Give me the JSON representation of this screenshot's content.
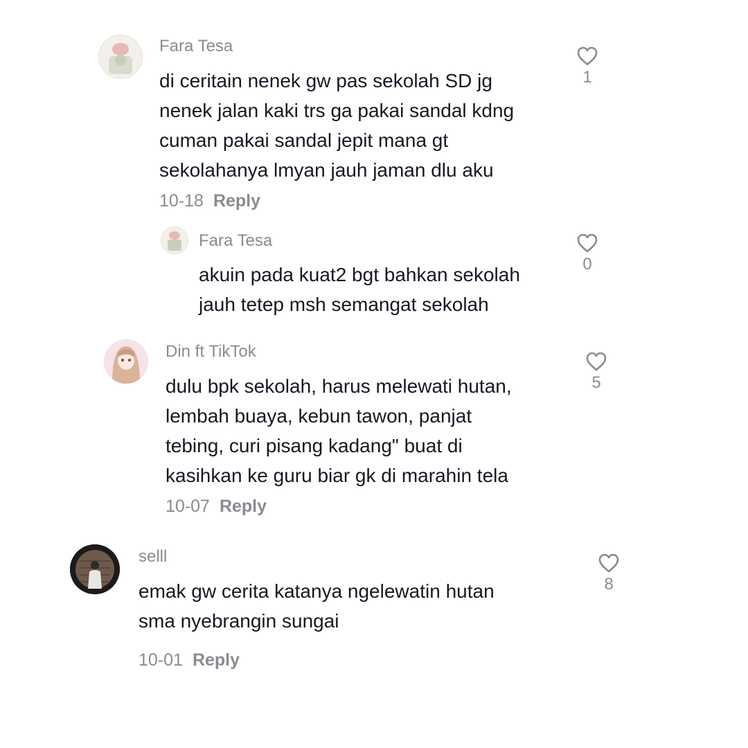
{
  "comments": [
    {
      "username": "Fara Tesa",
      "avatar": "avatar-photo-blurred",
      "lines": [
        "di ceritain nenek gw pas sekolah SD jg",
        "nenek jalan kaki trs ga pakai sandal kdng",
        "cuman pakai sandal jepit mana gt",
        "sekolahanya lmyan jauh jaman dlu aku"
      ],
      "date": "10-18",
      "reply_label": "Reply",
      "likes": "1",
      "icon": "heart-outline-icon"
    },
    {
      "username": "Fara Tesa",
      "avatar": "avatar-photo-blurred",
      "lines": [
        "akuin pada kuat2 bgt bahkan sekolah",
        "jauh tetep msh semangat sekolah"
      ],
      "likes": "0",
      "icon": "heart-outline-icon"
    },
    {
      "username": "Din ft TikTok",
      "avatar": "avatar-anime-girl",
      "lines": [
        "dulu bpk sekolah, harus melewati hutan,",
        "lembah buaya, kebun tawon, panjat",
        "tebing, curi pisang kadang\" buat di",
        "kasihkan ke guru biar gk di marahin tela"
      ],
      "date": "10-07",
      "reply_label": "Reply",
      "likes": "5",
      "icon": "heart-outline-icon"
    },
    {
      "username": "selll",
      "avatar": "avatar-person-brick-wall",
      "lines": [
        "emak gw cerita katanya ngelewatin hutan",
        "sma nyebrangin sungai"
      ],
      "date": "10-01",
      "reply_label": "Reply",
      "likes": "8",
      "icon": "heart-outline-icon"
    }
  ],
  "colors": {
    "text": "#161823",
    "muted": "#8a8b91",
    "background": "#ffffff"
  }
}
